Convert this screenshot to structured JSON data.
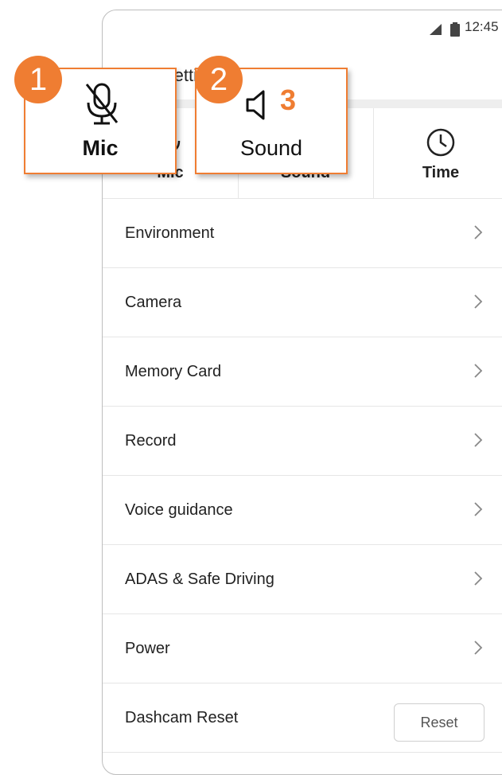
{
  "status": {
    "time": "12:45"
  },
  "header": {
    "title": "Settings"
  },
  "quick": [
    {
      "label": "Mic",
      "icon": "mic-icon"
    },
    {
      "label": "Sound",
      "icon": "speaker-icon"
    },
    {
      "label": "Time",
      "icon": "clock-icon"
    }
  ],
  "menu": [
    {
      "label": "Environment"
    },
    {
      "label": "Camera"
    },
    {
      "label": "Memory Card"
    },
    {
      "label": "Record"
    },
    {
      "label": "Voice guidance"
    },
    {
      "label": "ADAS & Safe Driving"
    },
    {
      "label": "Power"
    }
  ],
  "reset_row": {
    "label": "Dashcam Reset",
    "button": "Reset"
  },
  "callouts": {
    "mic": {
      "badge": "1",
      "label": "Mic",
      "icon": "mic-muted-icon"
    },
    "sound": {
      "badge": "2",
      "label": "Sound",
      "icon": "speaker-icon",
      "number": "3"
    }
  },
  "colors": {
    "accent": "#ef7d32",
    "divider": "#e6e6e6"
  }
}
